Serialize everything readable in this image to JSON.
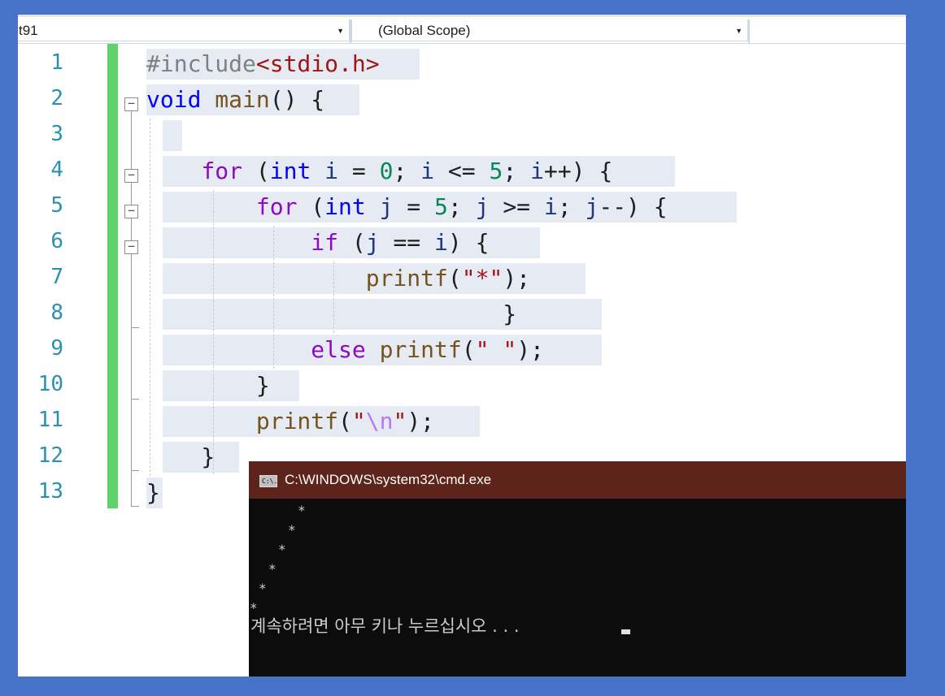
{
  "navigation_bar": {
    "project_combo": "t91",
    "scope_combo": "(Global Scope)"
  },
  "editor": {
    "line_numbers": [
      "1",
      "2",
      "3",
      "4",
      "5",
      "6",
      "7",
      "8",
      "9",
      "10",
      "11",
      "12",
      "13"
    ],
    "code_lines": [
      "#include<stdio.h>",
      "void main() {",
      "",
      "    for (int i = 0; i <= 5; i++) {",
      "        for (int j = 5; j >= i; j--) {",
      "            if (j == i) {",
      "                printf(\"*\");",
      "                          }",
      "            else printf(\" \");",
      "        }",
      "        printf(\"\\n\");",
      "    }",
      "}"
    ]
  },
  "console": {
    "title": "C:\\WINDOWS\\system32\\cmd.exe",
    "icon": "cmd-window-icon",
    "icon_text": "C:\\.",
    "output_lines": [
      "     *",
      "    *",
      "   *",
      "  *",
      " *",
      "*"
    ],
    "prompt": "계속하려면 아무 키나 누르십시오 . . ."
  },
  "colors": {
    "background": "#4673c9",
    "line_number": "#2b91af",
    "keyword": "#0000ff",
    "control_keyword": "#8f08c4",
    "function": "#74531f",
    "variable": "#1f377f",
    "number": "#098658",
    "string": "#a31515",
    "escape": "#b776fb",
    "preprocessor": "#808080",
    "change_bar": "#5fd36a",
    "console_title_bar": "#5c241a",
    "console_background": "#0c0c0c"
  }
}
